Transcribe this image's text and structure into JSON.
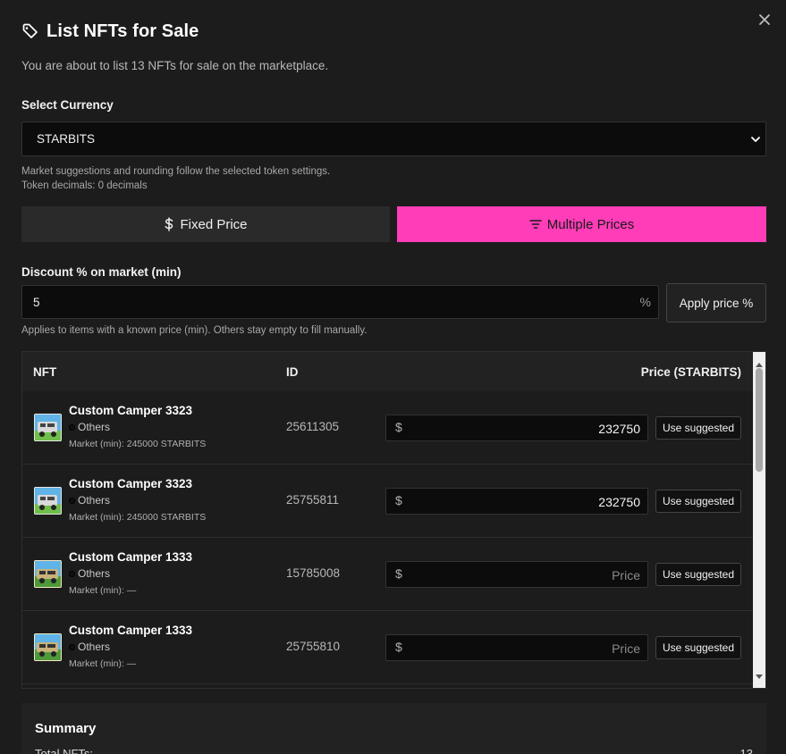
{
  "modal": {
    "title": "List NFTs for Sale",
    "subtitle": "You are about to list 13 NFTs for sale on the marketplace."
  },
  "currency": {
    "label": "Select Currency",
    "selected": "STARBITS",
    "hint_line1": "Market suggestions and rounding follow the selected token settings.",
    "hint_line2": "Token decimals: 0 decimals"
  },
  "pricing_mode": {
    "fixed_label": "Fixed Price",
    "multi_label": "Multiple Prices",
    "active": "multiple",
    "active_color": "#ff3db8"
  },
  "discount": {
    "label": "Discount % on market (min)",
    "value": "5",
    "suffix": "%",
    "apply_label": "Apply price %",
    "hint": "Applies to items with a known price (min). Others stay empty to fill manually."
  },
  "table": {
    "headers": {
      "nft": "NFT",
      "id": "ID",
      "price": "Price (STARBITS)"
    },
    "currency_symbol": "$",
    "price_placeholder": "Price",
    "suggest_label": "Use suggested",
    "rows": [
      {
        "name": "Custom Camper 3323",
        "collection": "Others",
        "market": "Market (min): 245000 STARBITS",
        "id": "25611305",
        "price": "232750"
      },
      {
        "name": "Custom Camper 3323",
        "collection": "Others",
        "market": "Market (min): 245000 STARBITS",
        "id": "25755811",
        "price": "232750"
      },
      {
        "name": "Custom Camper 1333",
        "collection": "Others",
        "market": "Market (min): —",
        "id": "15785008",
        "price": ""
      },
      {
        "name": "Custom Camper 1333",
        "collection": "Others",
        "market": "Market (min): —",
        "id": "25755810",
        "price": ""
      }
    ]
  },
  "summary": {
    "title": "Summary",
    "total_label": "Total NFTs:",
    "total_value": "13"
  }
}
